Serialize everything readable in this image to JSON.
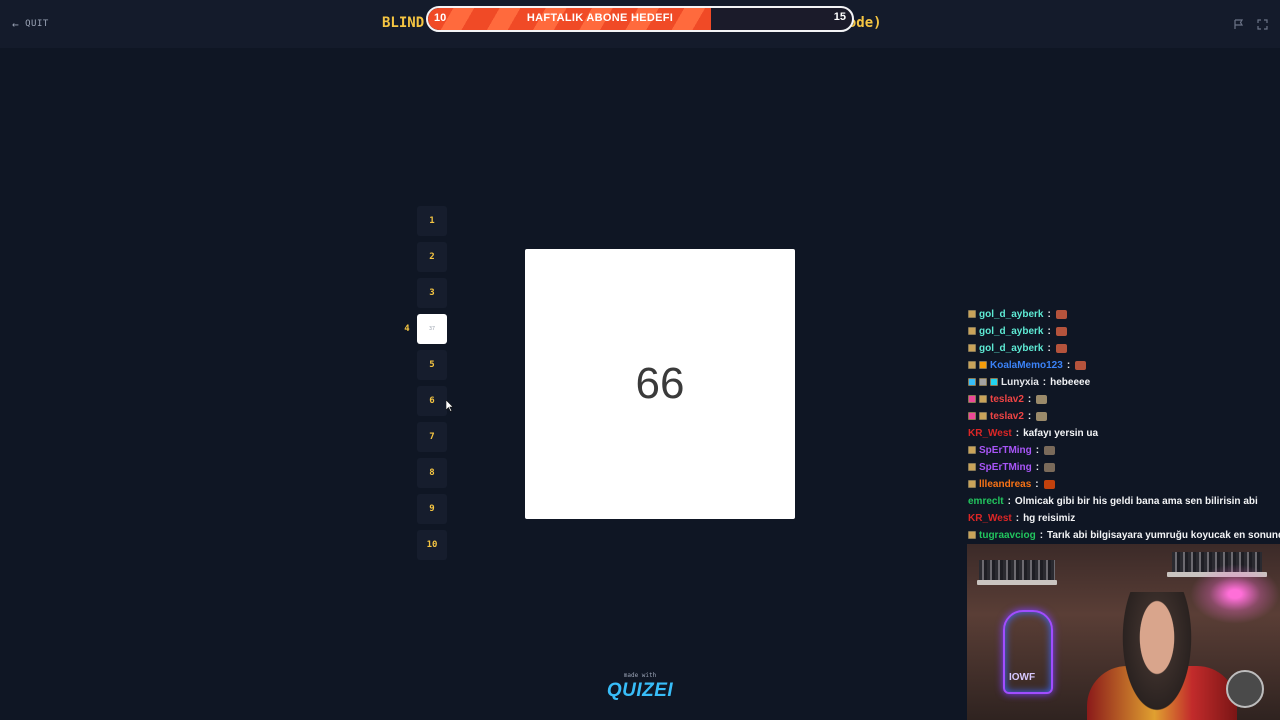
{
  "header": {
    "quit_label": "QUIT",
    "title_left": "BLIND",
    "title_right": "LARGE (extreme mode)",
    "sub_goal": {
      "label": "HAFTALIK ABONE HEDEFI",
      "current": "10",
      "target": "15",
      "progress": 0.667
    }
  },
  "board": {
    "slots": [
      {
        "label": "1"
      },
      {
        "label": "2"
      },
      {
        "label": "3"
      },
      {
        "label": "37",
        "side_label": "4"
      },
      {
        "label": "5"
      },
      {
        "label": "6"
      },
      {
        "label": "7"
      },
      {
        "label": "8"
      },
      {
        "label": "9"
      },
      {
        "label": "10"
      }
    ],
    "current_number": "66"
  },
  "chat": [
    {
      "user": "gol_d_ayberk",
      "color": "#5eead4",
      "msg": "",
      "badges": [
        "#c9a35a"
      ],
      "emote": "#b5533c"
    },
    {
      "user": "gol_d_ayberk",
      "color": "#5eead4",
      "msg": "",
      "badges": [
        "#c9a35a"
      ],
      "emote": "#b5533c"
    },
    {
      "user": "gol_d_ayberk",
      "color": "#5eead4",
      "msg": "",
      "badges": [
        "#c9a35a"
      ],
      "emote": "#b5533c"
    },
    {
      "user": "KoalaMemo123",
      "color": "#3b82f6",
      "msg": "",
      "badges": [
        "#c9a35a",
        "#f59e0b"
      ],
      "emote": "#b5533c"
    },
    {
      "user": "Lunyxia",
      "color": "#e5e7eb",
      "msg": "hebeeee",
      "badges": [
        "#38bdf8",
        "#a3a3a3",
        "#22d3ee"
      ],
      "emote": ""
    },
    {
      "user": "teslav2",
      "color": "#ef4444",
      "msg": "",
      "badges": [
        "#ec4899",
        "#c9a35a"
      ],
      "emote": "#9a8a6a"
    },
    {
      "user": "teslav2",
      "color": "#ef4444",
      "msg": "",
      "badges": [
        "#ec4899",
        "#c9a35a"
      ],
      "emote": "#9a8a6a"
    },
    {
      "user": "KR_West",
      "color": "#dc2626",
      "msg": "kafayı yersin ua",
      "badges": [],
      "emote": ""
    },
    {
      "user": "SpErTMing",
      "color": "#a855f7",
      "msg": "",
      "badges": [
        "#c9a35a"
      ],
      "emote": "#7a6a5a"
    },
    {
      "user": "SpErTMing",
      "color": "#a855f7",
      "msg": "",
      "badges": [
        "#c9a35a"
      ],
      "emote": "#7a6a5a"
    },
    {
      "user": "llleandreas",
      "color": "#f97316",
      "msg": "",
      "badges": [
        "#c9a35a"
      ],
      "emote": "#c2410c"
    },
    {
      "user": "emreclt",
      "color": "#22c55e",
      "msg": "Olmicak gibi bir his geldi bana ama sen bilirisin abi",
      "badges": [],
      "emote": ""
    },
    {
      "user": "KR_West",
      "color": "#dc2626",
      "msg": "hg reisimiz",
      "badges": [],
      "emote": ""
    },
    {
      "user": "tugraavciog",
      "color": "#22c55e",
      "msg": "Tarık abi bilgisayara yumruğu koyucak en sonunda",
      "badges": [
        "#c9a35a"
      ],
      "emote": ""
    }
  ],
  "footer": {
    "made_with": "made with",
    "brand": "QUIZEI"
  },
  "webcam": {
    "neon_sign": "IOWF"
  },
  "colors": {
    "accent": "#f5c542",
    "background": "#0f1624",
    "brand": "#38bdf8"
  }
}
